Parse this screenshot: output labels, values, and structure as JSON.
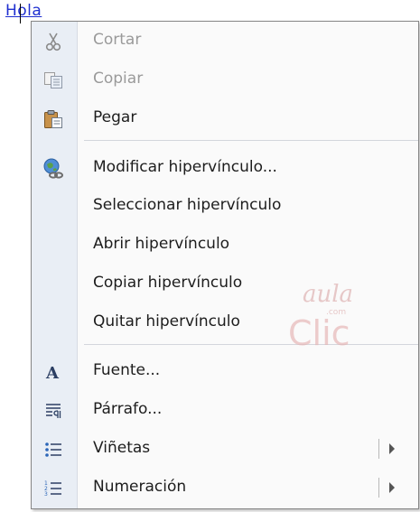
{
  "document": {
    "link_text": "Hola"
  },
  "menu": {
    "items": [
      {
        "label": "Cortar",
        "icon": "scissors-icon",
        "disabled": true
      },
      {
        "label": "Copiar",
        "icon": "copy-icon",
        "disabled": true
      },
      {
        "label": "Pegar",
        "icon": "paste-icon",
        "disabled": false
      },
      {
        "label": "Modificar hipervínculo...",
        "icon": "edit-hyperlink-icon",
        "disabled": false
      },
      {
        "label": "Seleccionar hipervínculo",
        "disabled": false
      },
      {
        "label": "Abrir hipervínculo",
        "disabled": false
      },
      {
        "label": "Copiar hipervínculo",
        "disabled": false
      },
      {
        "label": "Quitar hipervínculo",
        "disabled": false
      },
      {
        "label": "Fuente...",
        "icon": "font-icon",
        "disabled": false
      },
      {
        "label": "Párrafo...",
        "icon": "paragraph-icon",
        "disabled": false
      },
      {
        "label": "Viñetas",
        "icon": "bullets-icon",
        "disabled": false,
        "submenu": true
      },
      {
        "label": "Numeración",
        "icon": "numbering-icon",
        "disabled": false,
        "submenu": true
      }
    ]
  },
  "watermark": {
    "line1": "aula",
    "line2": "Clic",
    "domain": ".com"
  },
  "colors": {
    "link": "#1f2fd0",
    "gutter": "#e9eef5",
    "watermark": "#d9a0a0"
  }
}
